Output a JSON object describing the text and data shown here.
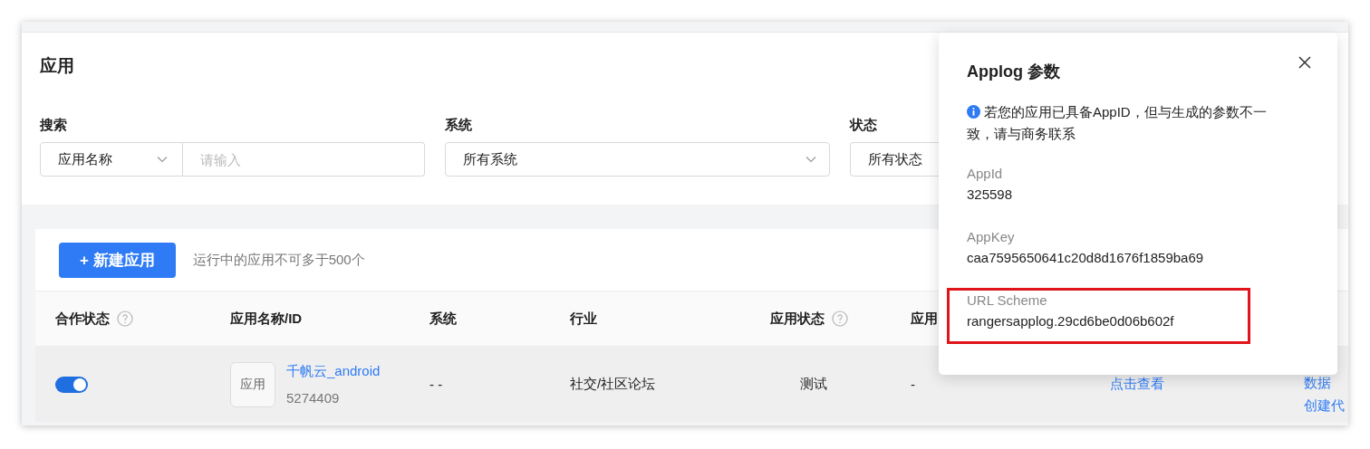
{
  "page": {
    "title": "应用"
  },
  "filters": [
    {
      "kind": "search",
      "label": "搜索",
      "select": "应用名称",
      "placeholder": "请输入"
    },
    {
      "kind": "select",
      "label": "系统",
      "value": "所有系统"
    },
    {
      "kind": "select",
      "label": "状态",
      "value": "所有状态"
    }
  ],
  "toolbar": {
    "button": "+ 新建应用",
    "note": "运行中的应用不可多于500个"
  },
  "table": {
    "columns": [
      {
        "label": "合作状态",
        "help": true
      },
      {
        "label": "应用名称/ID",
        "help": false
      },
      {
        "label": "系统",
        "help": false
      },
      {
        "label": "行业",
        "help": false
      },
      {
        "label": "应用状态",
        "help": true
      },
      {
        "label": "应用",
        "help": false
      }
    ],
    "rows": [
      {
        "cooperation_on": true,
        "icon_text": "应用",
        "name": "千帆云_android",
        "id": "5274409",
        "system": "- -",
        "industry": "社交/社区论坛",
        "status": "测试",
        "column_6": "-",
        "column_7": "点击查看",
        "column_8": [
          "数据",
          "创建代"
        ]
      }
    ]
  },
  "popover": {
    "title": "Applog 参数",
    "notice": "若您的应用已具备AppID，但与生成的参数不一致，请与商务联系",
    "fields": [
      {
        "label": "AppId",
        "value": "325598",
        "highlighted": false
      },
      {
        "label": "AppKey",
        "value": "caa7595650641c20d8d1676f1859ba69",
        "highlighted": false
      },
      {
        "label": "URL Scheme",
        "value": "rangersapplog.29cd6be0d06b602f",
        "highlighted": true
      }
    ]
  }
}
